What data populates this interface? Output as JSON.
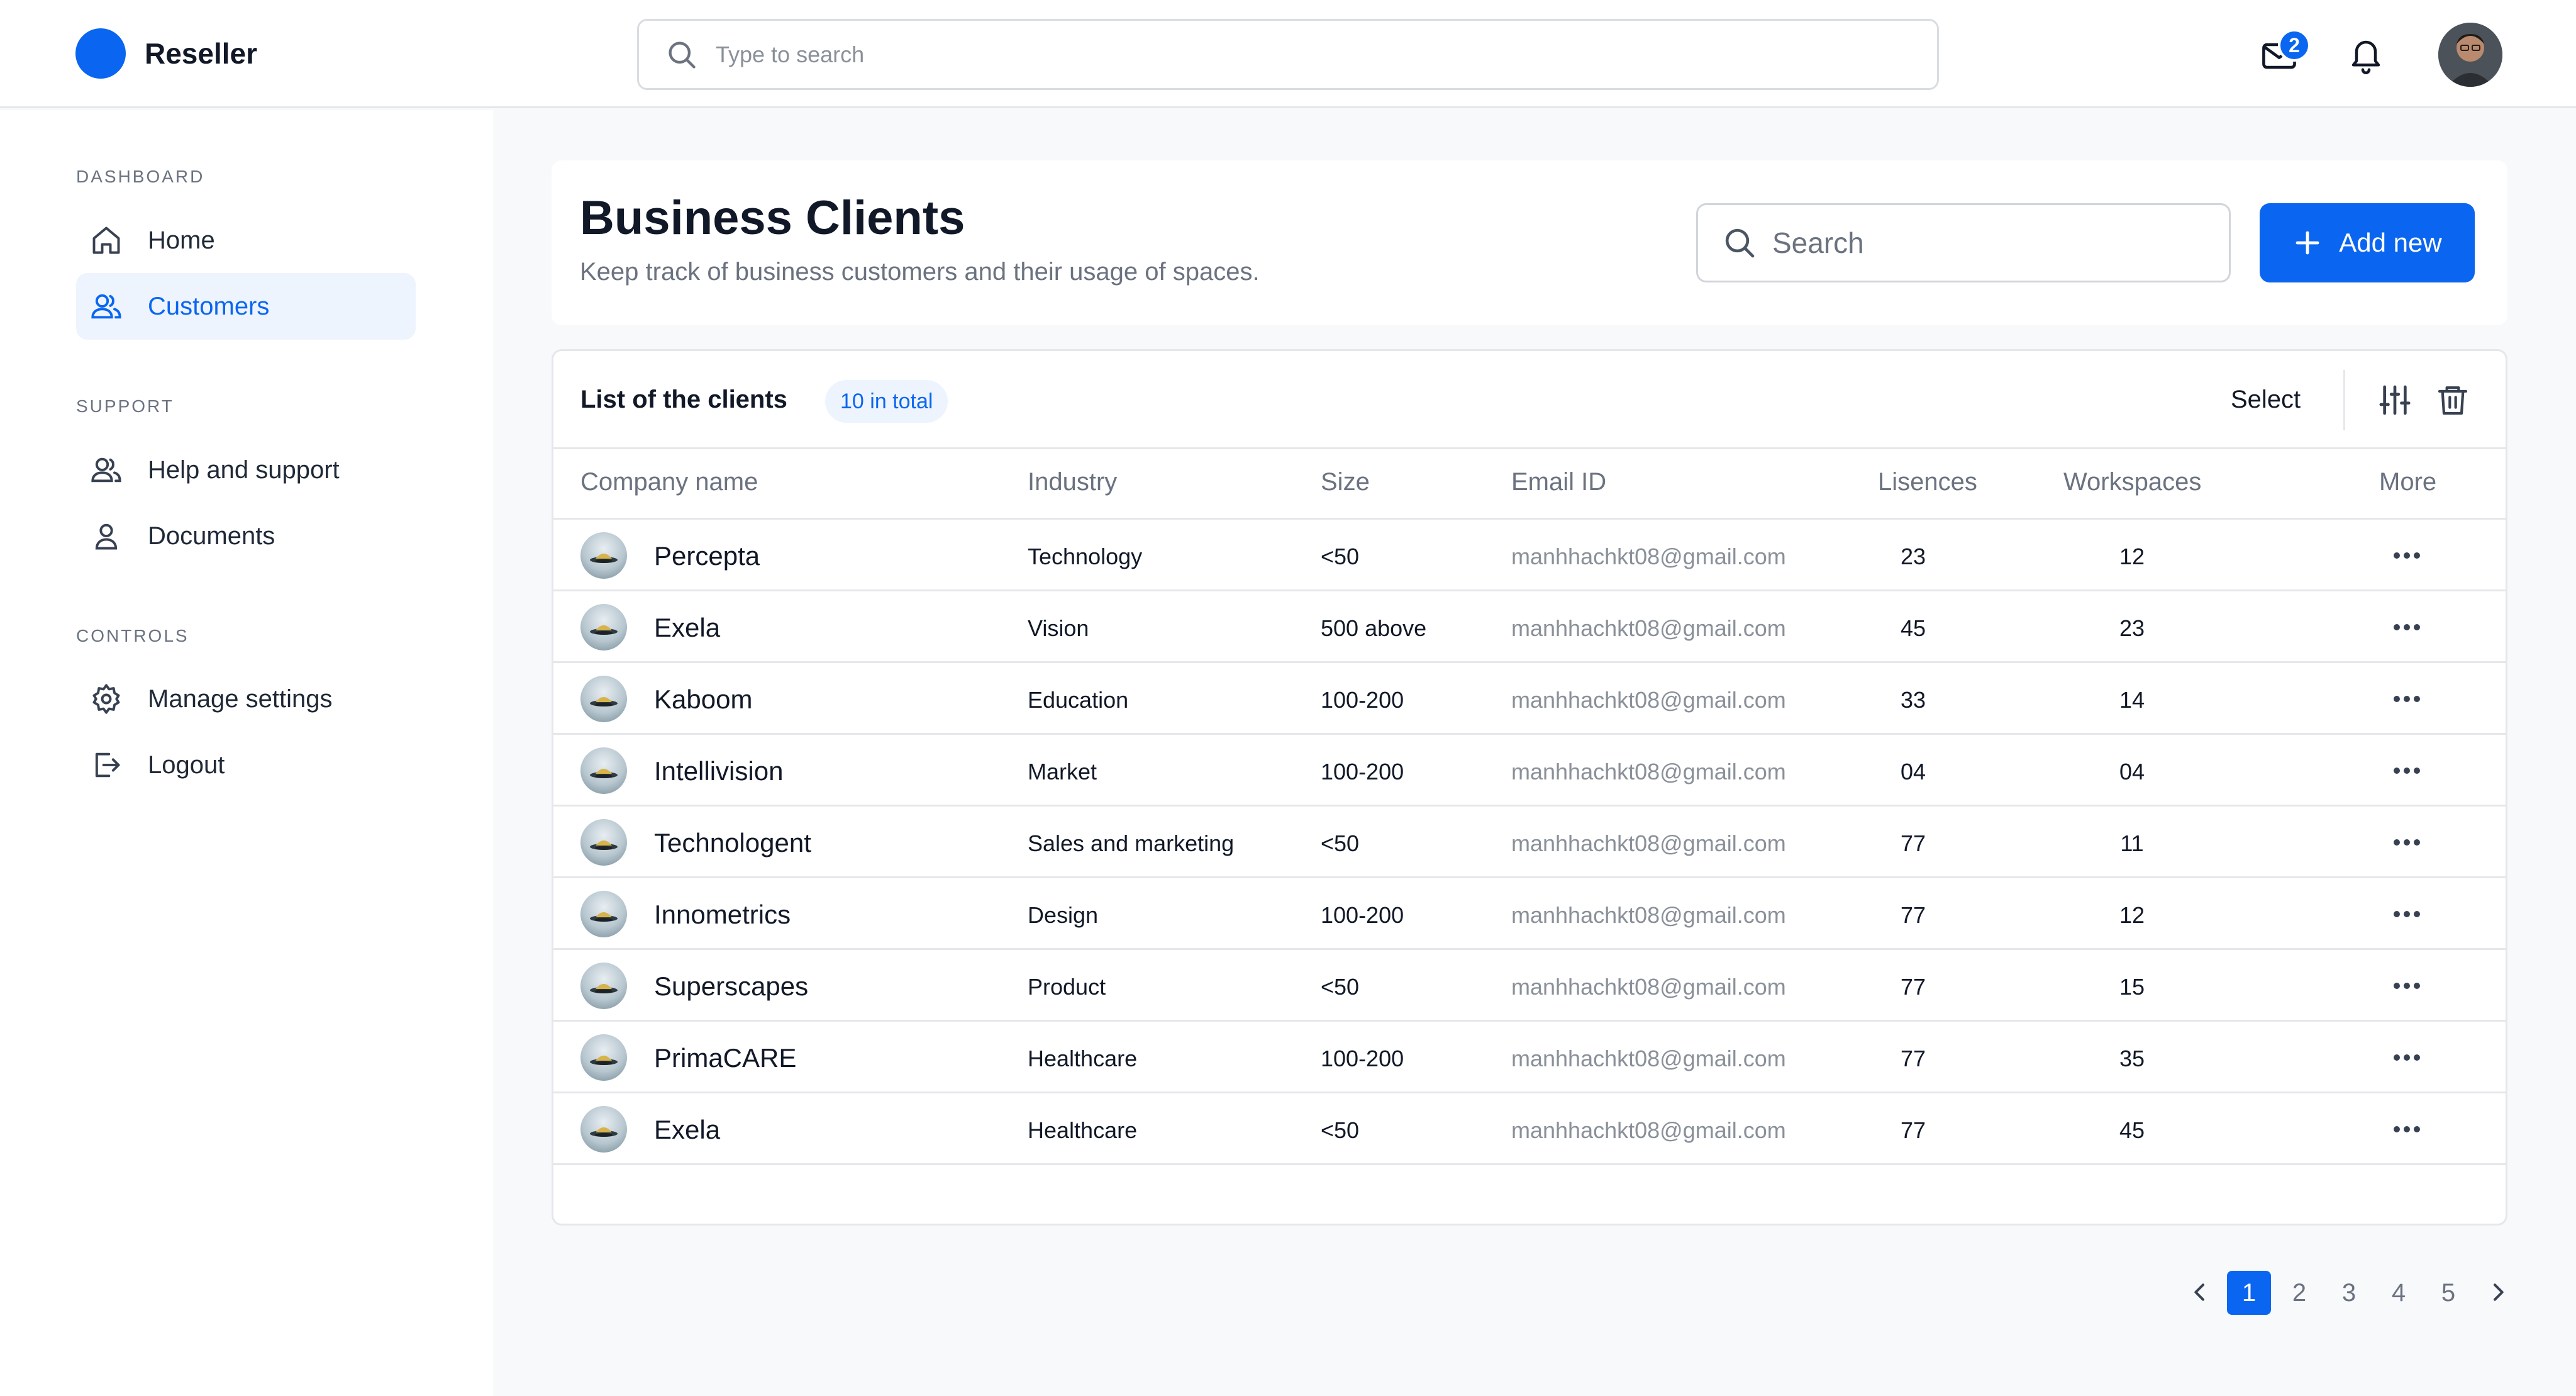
{
  "app": {
    "name": "Reseller"
  },
  "topbar": {
    "search_placeholder": "Type to search",
    "mail_badge": "2",
    "icons": [
      "search-icon",
      "mail-icon",
      "bell-icon"
    ]
  },
  "sidebar": {
    "sections": [
      {
        "title": "DASHBOARD",
        "items": [
          {
            "label": "Home",
            "icon": "home-icon",
            "active": false
          },
          {
            "label": "Customers",
            "icon": "users-icon",
            "active": true
          }
        ]
      },
      {
        "title": "SUPPORT",
        "items": [
          {
            "label": "Help and support",
            "icon": "users-icon",
            "active": false
          },
          {
            "label": "Documents",
            "icon": "user-icon",
            "active": false
          }
        ]
      },
      {
        "title": "CONTROLS",
        "items": [
          {
            "label": "Manage settings",
            "icon": "gear-icon",
            "active": false
          },
          {
            "label": "Logout",
            "icon": "logout-icon",
            "active": false
          }
        ]
      }
    ]
  },
  "header": {
    "title": "Business Clients",
    "subtitle": "Keep track of business customers and their usage of spaces.",
    "search_placeholder": "Search",
    "add_label": "Add new"
  },
  "table": {
    "title": "List of the clients",
    "total_badge": "10 in total",
    "select_label": "Select",
    "columns": [
      "Company name",
      "Industry",
      "Size",
      "Email ID",
      "Lisences",
      "Workspaces",
      "More"
    ],
    "rows": [
      {
        "company": "Percepta",
        "industry": "Technology",
        "size": "<50",
        "email": "manhhachkt08@gmail.com",
        "licences": "23",
        "workspaces": "12"
      },
      {
        "company": "Exela",
        "industry": "Vision",
        "size": "500 above",
        "email": "manhhachkt08@gmail.com",
        "licences": "45",
        "workspaces": "23"
      },
      {
        "company": "Kaboom",
        "industry": "Education",
        "size": "100-200",
        "email": "manhhachkt08@gmail.com",
        "licences": "33",
        "workspaces": "14"
      },
      {
        "company": "Intellivision",
        "industry": "Market",
        "size": "100-200",
        "email": "manhhachkt08@gmail.com",
        "licences": "04",
        "workspaces": "04"
      },
      {
        "company": "Technologent",
        "industry": "Sales and marketing",
        "size": "<50",
        "email": "manhhachkt08@gmail.com",
        "licences": "77",
        "workspaces": "11"
      },
      {
        "company": "Innometrics",
        "industry": "Design",
        "size": "100-200",
        "email": "manhhachkt08@gmail.com",
        "licences": "77",
        "workspaces": "12"
      },
      {
        "company": "Superscapes",
        "industry": "Product",
        "size": "<50",
        "email": "manhhachkt08@gmail.com",
        "licences": "77",
        "workspaces": "15"
      },
      {
        "company": "PrimaCARE",
        "industry": "Healthcare",
        "size": "100-200",
        "email": "manhhachkt08@gmail.com",
        "licences": "77",
        "workspaces": "35"
      },
      {
        "company": "Exela",
        "industry": "Healthcare",
        "size": "<50",
        "email": "manhhachkt08@gmail.com",
        "licences": "77",
        "workspaces": "45"
      }
    ]
  },
  "pagination": {
    "pages": [
      "1",
      "2",
      "3",
      "4",
      "5"
    ],
    "current": "1"
  },
  "colors": {
    "accent": "#0A66F0",
    "background": "#F8F9FB",
    "border": "#E5E7EB"
  }
}
